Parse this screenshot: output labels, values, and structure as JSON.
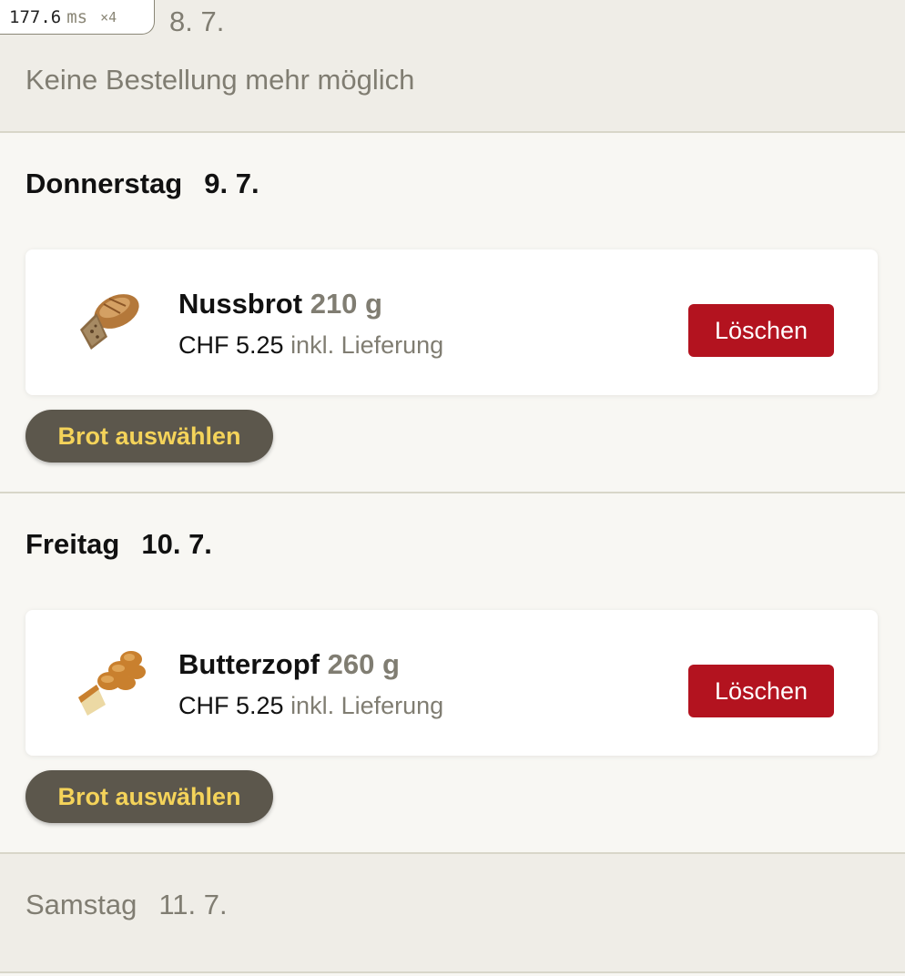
{
  "perf": {
    "value": "177.6",
    "unit": "ms",
    "multiplier": "×4"
  },
  "day_closed": {
    "date": "8. 7.",
    "message": "Keine Bestellung mehr möglich"
  },
  "days": [
    {
      "weekday": "Donnerstag",
      "date": "9. 7.",
      "order": {
        "name": "Nussbrot",
        "weight": "210 g",
        "price": "CHF 5.25",
        "delivery": "inkl. Lieferung",
        "image_icon": "nussbrot-image",
        "delete_label": "Löschen"
      },
      "choose_label": "Brot auswählen"
    },
    {
      "weekday": "Freitag",
      "date": "10. 7.",
      "order": {
        "name": "Butterzopf",
        "weight": "260 g",
        "price": "CHF 5.25",
        "delivery": "inkl. Lieferung",
        "image_icon": "butterzopf-image",
        "delete_label": "Löschen"
      },
      "choose_label": "Brot auswählen"
    }
  ],
  "day_future": {
    "weekday": "Samstag",
    "date": "11. 7."
  },
  "colors": {
    "background": "#f8f7f3",
    "closed_background": "#efede7",
    "delete_red": "#b3131f",
    "choose_bg": "#5c574c",
    "choose_text": "#f4d35a",
    "muted_text": "#807d72"
  }
}
